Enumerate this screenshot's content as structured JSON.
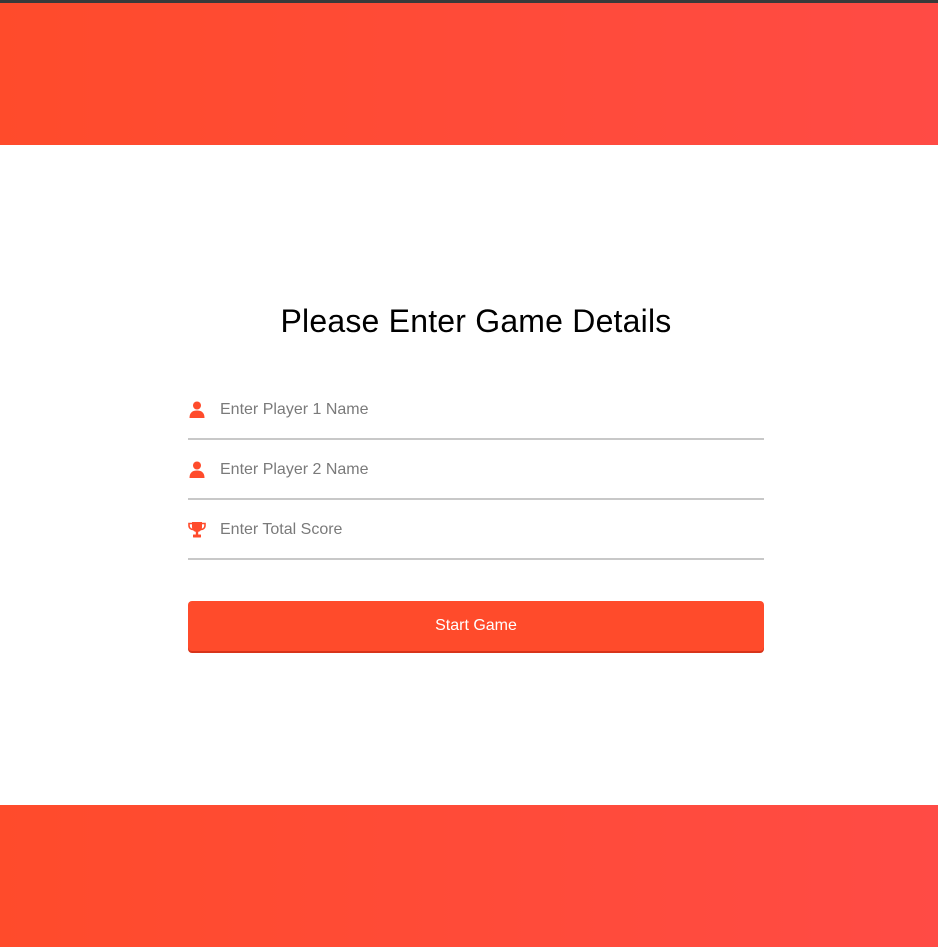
{
  "header": {},
  "form": {
    "title": "Please Enter Game Details",
    "fields": [
      {
        "icon": "user-icon",
        "placeholder": "Enter Player 1 Name",
        "value": ""
      },
      {
        "icon": "user-icon",
        "placeholder": "Enter Player 2 Name",
        "value": ""
      },
      {
        "icon": "trophy-icon",
        "placeholder": "Enter Total Score",
        "value": ""
      }
    ],
    "submit_label": "Start Game"
  },
  "colors": {
    "accent": "#ff4b2b",
    "gradient_end": "#ff4b45",
    "underline": "#c8c8c8"
  }
}
